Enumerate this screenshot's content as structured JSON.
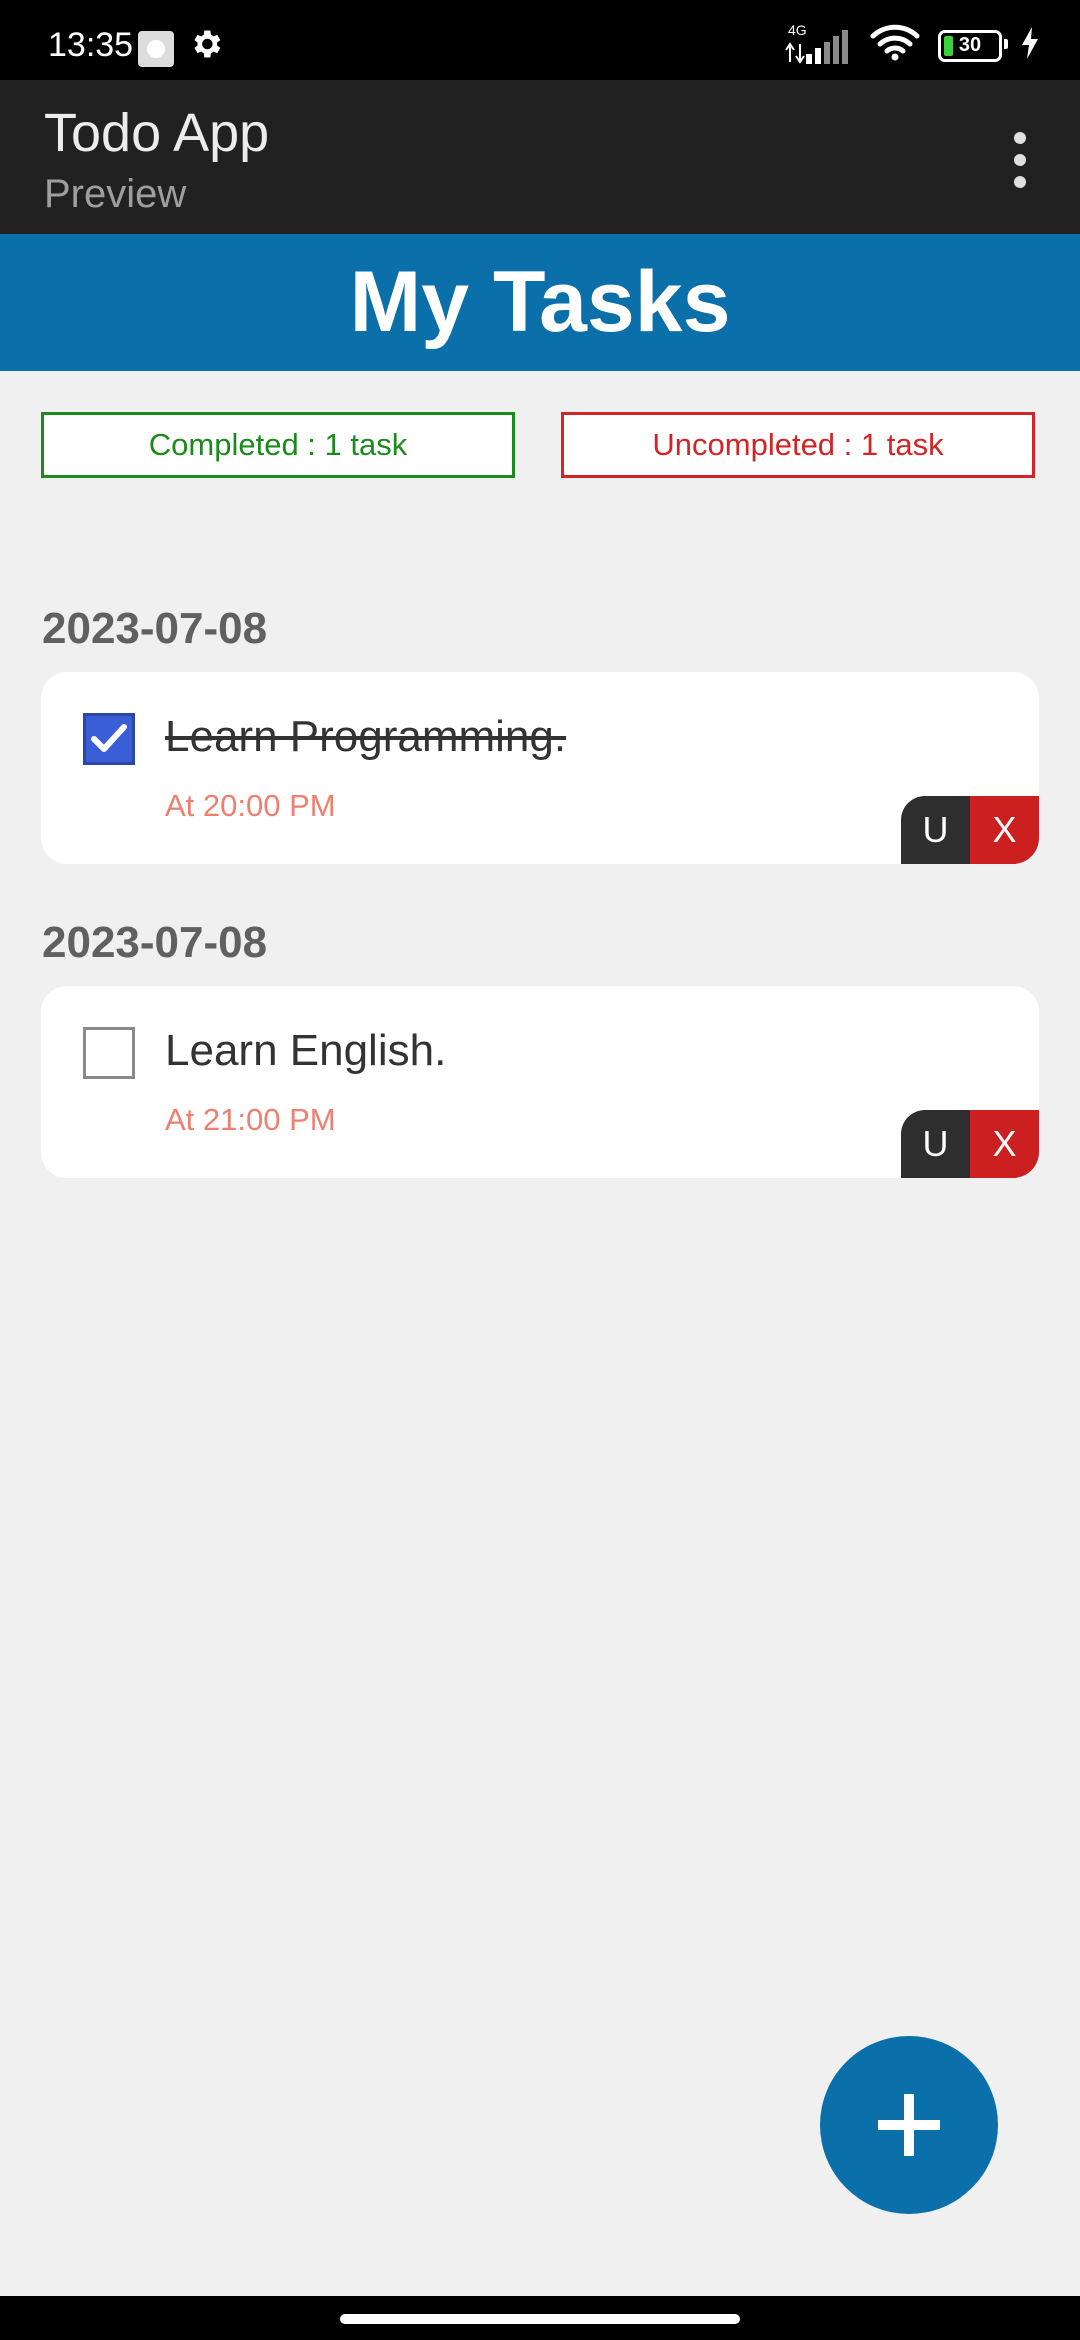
{
  "status_bar": {
    "time": "13:35",
    "network": "4G",
    "battery": "30"
  },
  "app_bar": {
    "title": "Todo App",
    "subtitle": "Preview"
  },
  "header": {
    "title": "My Tasks"
  },
  "counters": {
    "completed": "Completed : 1 task",
    "uncompleted": "Uncompleted : 1 task"
  },
  "groups": [
    {
      "date": "2023-07-08",
      "task": {
        "text": "Learn Programming.",
        "time": "At 20:00 PM",
        "done": true
      }
    },
    {
      "date": "2023-07-08",
      "task": {
        "text": "Learn English.",
        "time": "At 21:00 PM",
        "done": false
      }
    }
  ],
  "actions": {
    "update_label": "U",
    "delete_label": "X"
  },
  "colors": {
    "accent": "#0b6faa",
    "app_bar": "#212121",
    "completed": "#1c8a1c",
    "uncompleted": "#d32525",
    "time_text": "#ef8070"
  },
  "icons": {
    "fab": "plus-icon",
    "menu": "more-vert-icon",
    "status": [
      "settings-icon",
      "signal-icon",
      "wifi-icon",
      "battery-icon",
      "charging-icon"
    ]
  }
}
